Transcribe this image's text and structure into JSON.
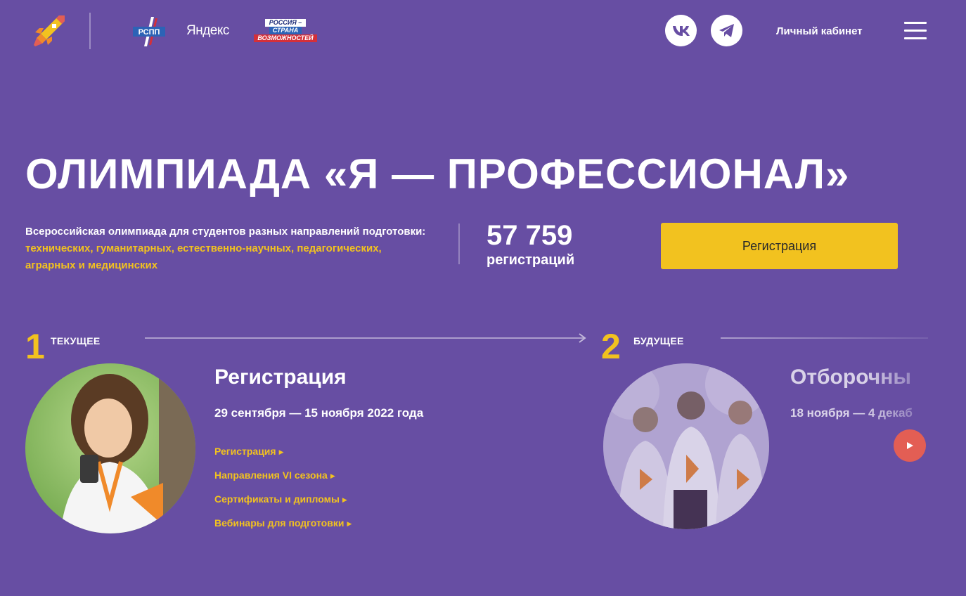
{
  "header": {
    "logo_icon": "rocket-icon",
    "partners": {
      "rspp": "РСПП",
      "yandex": "Яндекс",
      "russia_lines": [
        "РОССИЯ –",
        "СТРАНА",
        "ВОЗМОЖНОСТЕЙ"
      ]
    },
    "social": [
      {
        "icon": "vk-icon",
        "label": "VK"
      },
      {
        "icon": "telegram-icon",
        "label": "Telegram"
      }
    ],
    "cabinet_label": "Личный кабинет",
    "menu_icon": "burger-menu-icon"
  },
  "hero": {
    "title": "ОЛИМПИАДА «Я — ПРОФЕССИОНАЛ»",
    "description_plain": "Всероссийская олимпиада для студентов разных направлений подготовки: ",
    "description_highlight": "технических, гуманитарных, естественно-научных, педагогических, аграрных и медицинских",
    "stat_value": "57 759",
    "stat_label": "регистраций",
    "register_button": "Регистрация"
  },
  "stages": {
    "current": {
      "number": "1",
      "label": "ТЕКУЩЕЕ",
      "title": "Регистрация",
      "dates": "29 сентября — 15 ноября 2022 года",
      "links": [
        "Регистрация",
        "Направления VI сезона",
        "Сертификаты и дипломы",
        "Вебинары для подготовки"
      ]
    },
    "future": {
      "number": "2",
      "label": "БУДУЩЕЕ",
      "title": "Отборочны",
      "dates": "18 ноября — 4 декаб"
    }
  },
  "colors": {
    "background": "#674ea3",
    "accent_yellow": "#f2c21f",
    "play_red": "#e35e54"
  },
  "play_icon": "play-icon"
}
